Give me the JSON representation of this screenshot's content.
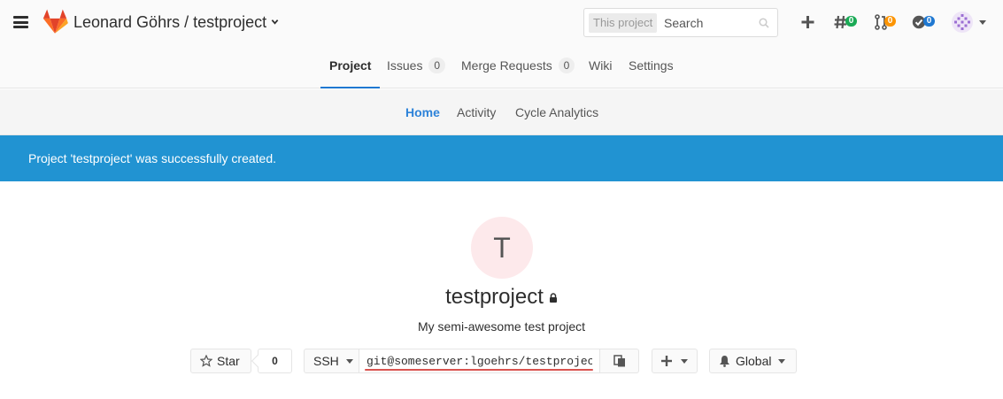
{
  "header": {
    "project_path": "Leonard Göhrs / testproject",
    "search": {
      "scope": "This project",
      "placeholder": "Search"
    },
    "badges": {
      "issues": "0",
      "merge_requests": "0",
      "todos": "0"
    },
    "colors": {
      "issues_badge": "#1aaa55",
      "mr_badge": "#fc9403",
      "todos_badge": "#1f78d1"
    }
  },
  "nav": {
    "tabs": [
      {
        "label": "Project",
        "active": true
      },
      {
        "label": "Issues",
        "count": "0"
      },
      {
        "label": "Merge Requests",
        "count": "0"
      },
      {
        "label": "Wiki"
      },
      {
        "label": "Settings"
      }
    ]
  },
  "subnav": {
    "tabs": [
      {
        "label": "Home",
        "active": true
      },
      {
        "label": "Activity"
      },
      {
        "label": "Cycle Analytics"
      }
    ]
  },
  "flash": {
    "message": "Project 'testproject' was successfully created."
  },
  "project": {
    "avatar_letter": "T",
    "name": "testproject",
    "description": "My semi-awesome test project",
    "star_label": "Star",
    "star_count": "0",
    "clone_protocol": "SSH",
    "clone_url": "git@someserver:lgoehrs/testproject.git",
    "notification_level": "Global"
  }
}
